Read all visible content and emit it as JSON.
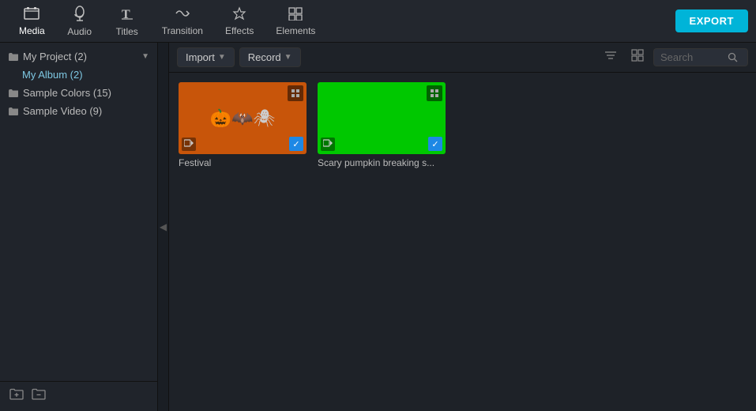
{
  "toolbar": {
    "export_label": "EXPORT",
    "items": [
      {
        "id": "media",
        "label": "Media",
        "icon": "🗂"
      },
      {
        "id": "audio",
        "label": "Audio",
        "icon": "♪"
      },
      {
        "id": "titles",
        "label": "Titles",
        "icon": "T"
      },
      {
        "id": "transition",
        "label": "Transition",
        "icon": "⇌"
      },
      {
        "id": "effects",
        "label": "Effects",
        "icon": "✦"
      },
      {
        "id": "elements",
        "label": "Elements",
        "icon": "🖼"
      }
    ]
  },
  "sidebar": {
    "tree_items": [
      {
        "id": "my-project",
        "label": "My Project (2)",
        "indent": false,
        "has_arrow": true
      },
      {
        "id": "my-album",
        "label": "My Album (2)",
        "indent": true,
        "has_arrow": false
      },
      {
        "id": "sample-colors",
        "label": "Sample Colors (15)",
        "indent": false,
        "has_arrow": false
      },
      {
        "id": "sample-video",
        "label": "Sample Video (9)",
        "indent": false,
        "has_arrow": false
      }
    ],
    "footer_icons": [
      "new-folder-icon",
      "delete-folder-icon"
    ]
  },
  "content_toolbar": {
    "import_label": "Import",
    "record_label": "Record",
    "search_placeholder": "Search"
  },
  "media_items": [
    {
      "id": "festival",
      "label": "Festival",
      "thumb_type": "festival",
      "checked": true
    },
    {
      "id": "scary-pumpkin",
      "label": "Scary pumpkin breaking s...",
      "thumb_type": "scary",
      "checked": true
    }
  ]
}
